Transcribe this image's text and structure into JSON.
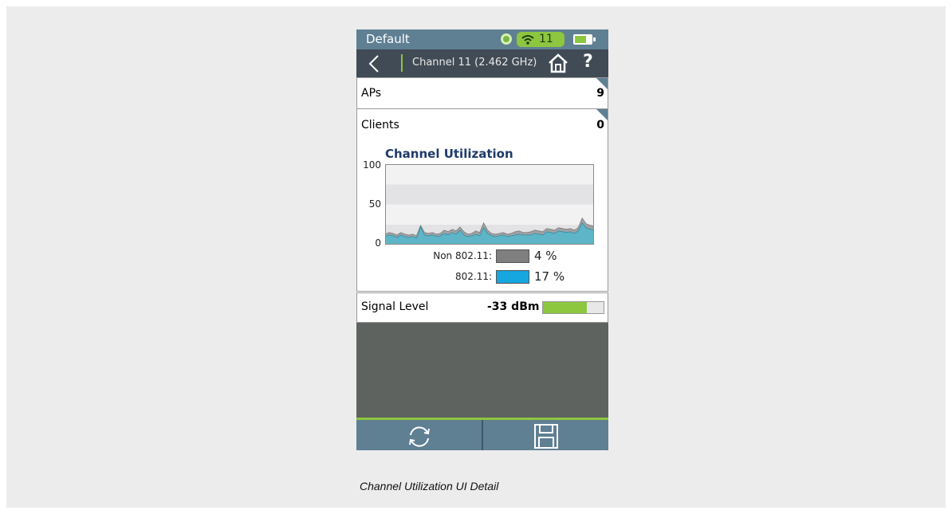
{
  "status_bar": {
    "profile": "Default",
    "channel_badge": "11",
    "icons": [
      "status-dot-icon",
      "wifi-icon",
      "battery-icon"
    ]
  },
  "nav": {
    "title": "Channel 11 (2.462 GHz)",
    "help": "?",
    "icons": [
      "back-arrow-icon",
      "home-icon"
    ]
  },
  "rows": {
    "aps": {
      "label": "APs",
      "value": "9"
    },
    "clients": {
      "label": "Clients",
      "value": "0"
    }
  },
  "chart": {
    "title": "Channel Utilization",
    "yticks": [
      "100",
      "50",
      "0"
    ],
    "legend": [
      {
        "label": "Non 802.11:",
        "value": "4 %",
        "color": "#7f7f80"
      },
      {
        "label": "802.11:",
        "value": "17 %",
        "color": "#16a6e0"
      }
    ]
  },
  "chart_data": {
    "type": "area",
    "title": "Channel Utilization",
    "ylim": [
      0,
      100
    ],
    "yticks": [
      0,
      50,
      100
    ],
    "series": [
      {
        "name": "Non 802.11",
        "color": "#9d9d9f",
        "values": [
          13,
          15,
          14,
          12,
          15,
          13,
          12,
          13,
          11,
          24,
          15,
          14,
          15,
          13,
          14,
          18,
          16,
          19,
          17,
          22,
          16,
          13,
          14,
          17,
          15,
          27,
          18,
          14,
          13,
          14,
          15,
          13,
          14,
          16,
          17,
          15,
          15,
          16,
          18,
          17,
          16,
          20,
          19,
          18,
          21,
          20,
          19,
          20,
          18,
          21,
          33,
          26,
          24,
          23
        ]
      },
      {
        "name": "802.11",
        "color": "#5bb6c9",
        "values": [
          10,
          12,
          11,
          9,
          12,
          10,
          9,
          10,
          8,
          22,
          12,
          11,
          12,
          10,
          11,
          14,
          12,
          15,
          13,
          18,
          12,
          10,
          11,
          13,
          11,
          21,
          14,
          11,
          10,
          11,
          12,
          10,
          11,
          12,
          13,
          12,
          12,
          12,
          14,
          13,
          12,
          16,
          15,
          14,
          17,
          16,
          15,
          16,
          14,
          17,
          27,
          21,
          19,
          18
        ]
      }
    ]
  },
  "signal": {
    "label": "Signal Level",
    "value": "-33 dBm",
    "level_percent": 72
  },
  "bottom": {
    "icons": [
      "refresh-icon",
      "save-icon"
    ]
  },
  "caption": "Channel Utilization UI Detail",
  "colors": {
    "header": "#5f7f93",
    "nav": "#414b55",
    "accent": "#8dc63f",
    "empty_area": "#5f6360"
  }
}
